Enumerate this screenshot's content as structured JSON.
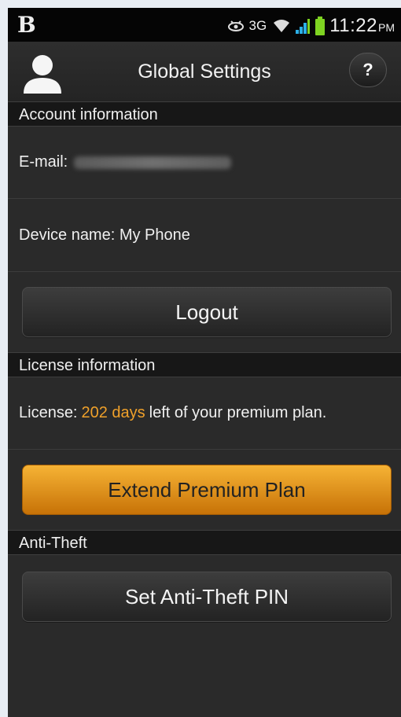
{
  "status_bar": {
    "logo": "B",
    "network": "3G",
    "time": "11:22",
    "ampm": "PM",
    "icons": [
      "eye-icon",
      "wifi-icon",
      "signal-icon",
      "battery-icon"
    ],
    "colors": {
      "signal": "#2bb0e8",
      "battery": "#7ed321"
    }
  },
  "header": {
    "title": "Global Settings",
    "help_label": "?",
    "icons": [
      "user-avatar-icon"
    ]
  },
  "account": {
    "section_title": "Account information",
    "email_label": "E-mail:",
    "email_value": "",
    "device_label": "Device name: My Phone",
    "logout_label": "Logout"
  },
  "license": {
    "section_title": "License information",
    "prefix": "License:",
    "days": "202 days",
    "suffix": "left of your premium plan.",
    "extend_label": "Extend Premium Plan",
    "accent_color": "#f0a12a"
  },
  "anti_theft": {
    "section_title": "Anti-Theft",
    "set_pin_label": "Set Anti-Theft PIN"
  }
}
